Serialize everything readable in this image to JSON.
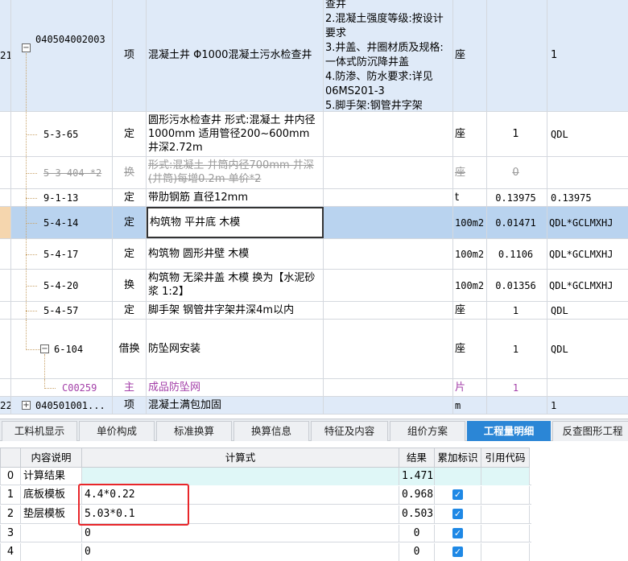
{
  "rows": [
    {
      "num": "21",
      "code": "040504002003",
      "type": "项",
      "name": "混凝土井 Φ1000混凝土污水检查井",
      "features": "查井\n2.混凝土强度等级:按设计要求\n3.井盖、井圈材质及规格:一体式防沉降井盖\n4.防渗、防水要求:详见06MS201-3\n5.脚手架:钢管井字架",
      "unit": "座",
      "qty": "",
      "expr": "1"
    },
    {
      "code": "5-3-65",
      "type": "定",
      "name": "圆形污水检查井 形式:混凝土 井内径1000mm 适用管径200~600mm 井深2.72m",
      "unit": "座",
      "qty": "1",
      "expr": "QDL"
    },
    {
      "code": "5-3-404 *2",
      "type": "换",
      "name": "形式:混凝土 井筒内径700mm 井深(井筒)每增0.2m 单价*2",
      "unit": "座",
      "qty": "0",
      "expr": ""
    },
    {
      "code": "9-1-13",
      "type": "定",
      "name": "带肋钢筋 直径12mm",
      "unit": "t",
      "qty": "0.13975",
      "expr": "0.13975"
    },
    {
      "code": "5-4-14",
      "type": "定",
      "name": "构筑物 平井底 木模",
      "unit": "100m2",
      "qty": "0.01471",
      "expr": "QDL*GCLMXHJ"
    },
    {
      "code": "5-4-17",
      "type": "定",
      "name": "构筑物 圆形井壁 木模",
      "unit": "100m2",
      "qty": "0.1106",
      "expr": "QDL*GCLMXHJ"
    },
    {
      "code": "5-4-20",
      "type": "换",
      "name": "构筑物 无梁井盖 木模  换为【水泥砂浆 1:2】",
      "unit": "100m2",
      "qty": "0.01356",
      "expr": "QDL*GCLMXHJ"
    },
    {
      "code": "5-4-57",
      "type": "定",
      "name": "脚手架 钢管井字架井深4m以内",
      "unit": "座",
      "qty": "1",
      "expr": "QDL"
    },
    {
      "code": "6-104",
      "type": "借换",
      "name": "防坠网安装",
      "unit": "座",
      "qty": "1",
      "expr": "QDL"
    },
    {
      "code": "C00259",
      "type": "主",
      "name": "成品防坠网",
      "unit": "片",
      "qty": "1",
      "expr": ""
    },
    {
      "num": "22",
      "code": "040501001...",
      "type": "项",
      "name": "混凝土满包加固",
      "unit": "m",
      "qty": "",
      "expr": "1"
    }
  ],
  "tabs": [
    "工料机显示",
    "单价构成",
    "标准换算",
    "换算信息",
    "特征及内容",
    "组价方案",
    "工程量明细",
    "反查图形工程"
  ],
  "active_tab": "工程量明细",
  "detail": {
    "headers": [
      "内容说明",
      "计算式",
      "结果",
      "累加标识",
      "引用代码"
    ],
    "rows": [
      {
        "idx": "0",
        "desc": "计算结果",
        "expr": "",
        "result": "1.471",
        "checked": false
      },
      {
        "idx": "1",
        "desc": "底板模板",
        "expr": "4.4*0.22",
        "result": "0.968",
        "checked": true
      },
      {
        "idx": "2",
        "desc": "垫层模板",
        "expr": "5.03*0.1",
        "result": "0.503",
        "checked": true
      },
      {
        "idx": "3",
        "desc": "",
        "expr": "0",
        "result": "0",
        "checked": true
      },
      {
        "idx": "4",
        "desc": "",
        "expr": "0",
        "result": "0",
        "checked": true
      }
    ]
  },
  "colors": {
    "accent": "#2b86d6",
    "highlight": "#e8262a",
    "selected_row": "#b9d3ef",
    "item_row": "#dfeaf8",
    "material": "#a33fa8"
  },
  "icons": {
    "collapse": "minus-box-icon",
    "expand": "plus-box-icon",
    "check": "checkbox-checked-icon"
  }
}
